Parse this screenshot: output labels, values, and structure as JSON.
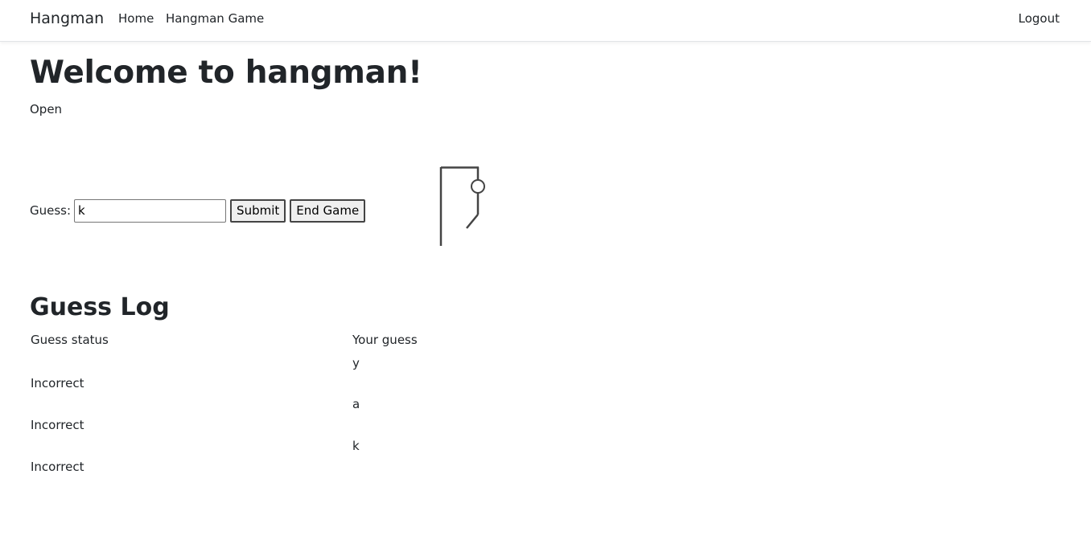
{
  "nav": {
    "brand": "Hangman",
    "links": [
      "Home",
      "Hangman Game"
    ],
    "logout": "Logout"
  },
  "main": {
    "title": "Welcome to hangman!",
    "status": "Open"
  },
  "guess_form": {
    "label": "Guess:",
    "value": "k",
    "submit_label": "Submit",
    "end_label": "End Game"
  },
  "hangman": {
    "wrong_guesses": 3
  },
  "log": {
    "title": "Guess Log",
    "headers": [
      "Guess status",
      "Your guess"
    ],
    "rows": [
      {
        "guess": "y",
        "status": "Incorrect"
      },
      {
        "guess": "a",
        "status": "Incorrect"
      },
      {
        "guess": "k",
        "status": "Incorrect"
      }
    ]
  }
}
